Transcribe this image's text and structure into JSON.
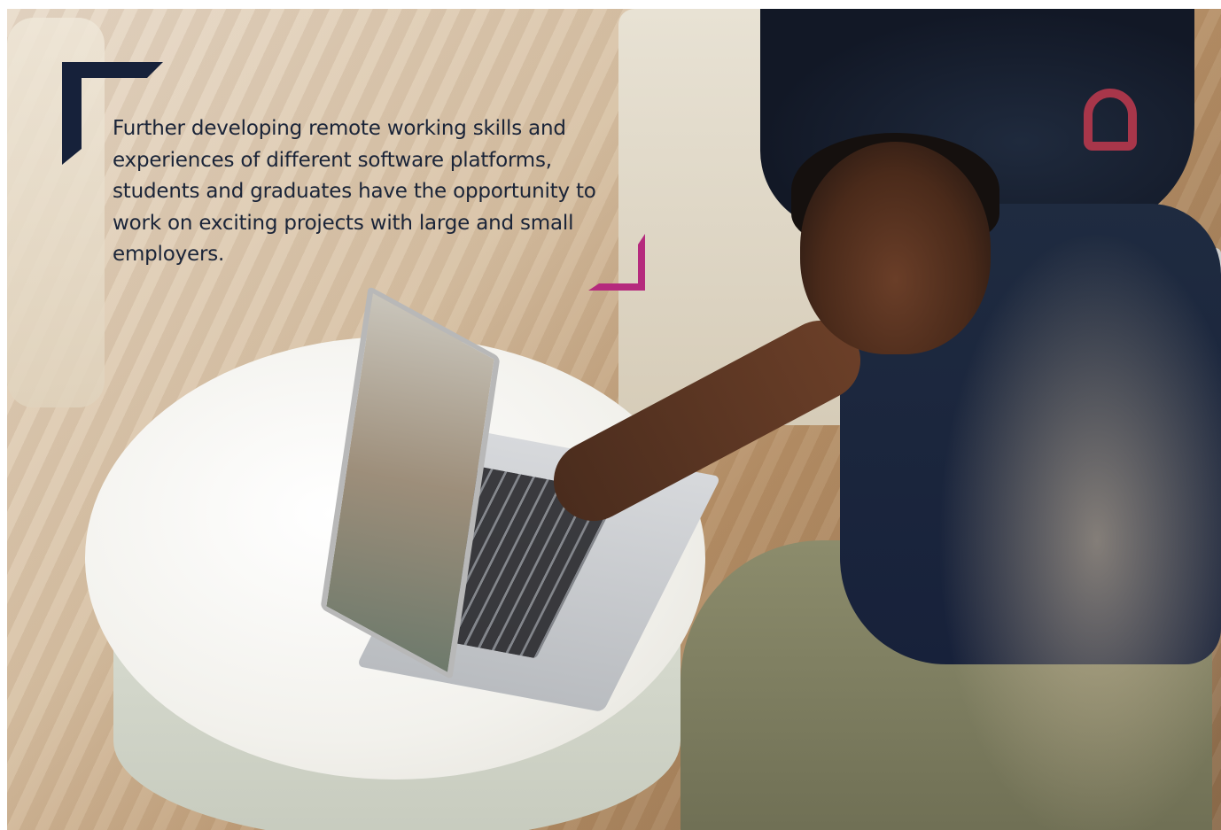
{
  "caption": {
    "text": "Further developing remote working skills and experiences of different software platforms, students and graduates have the opportunity to work on exciting projects with large and small employers."
  },
  "colors": {
    "navy_accent": "#16213a",
    "magenta_accent": "#b52a7d",
    "text": "#1a2438"
  }
}
